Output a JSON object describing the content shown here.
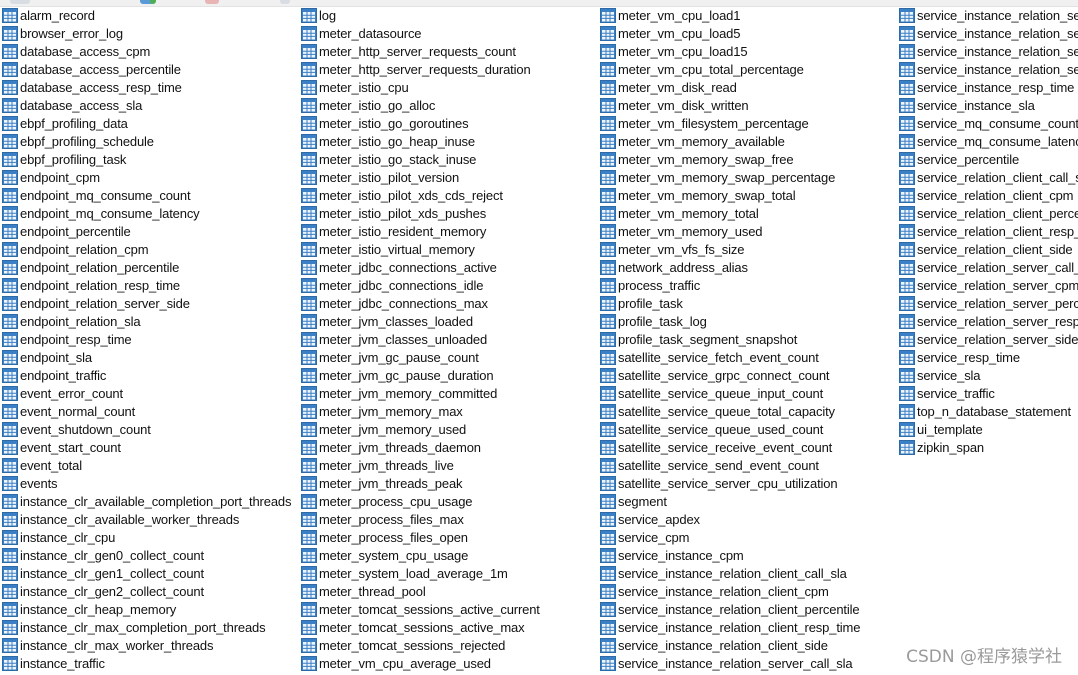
{
  "colors": {
    "table_icon": "#3b7fc4",
    "icon_grid": "#ffffff",
    "text": "#111111",
    "watermark": "#9a9a9a"
  },
  "icons": {
    "table": "table-grid-icon"
  },
  "columns": [
    {
      "items": [
        "alarm_record",
        "browser_error_log",
        "database_access_cpm",
        "database_access_percentile",
        "database_access_resp_time",
        "database_access_sla",
        "ebpf_profiling_data",
        "ebpf_profiling_schedule",
        "ebpf_profiling_task",
        "endpoint_cpm",
        "endpoint_mq_consume_count",
        "endpoint_mq_consume_latency",
        "endpoint_percentile",
        "endpoint_relation_cpm",
        "endpoint_relation_percentile",
        "endpoint_relation_resp_time",
        "endpoint_relation_server_side",
        "endpoint_relation_sla",
        "endpoint_resp_time",
        "endpoint_sla",
        "endpoint_traffic",
        "event_error_count",
        "event_normal_count",
        "event_shutdown_count",
        "event_start_count",
        "event_total",
        "events",
        "instance_clr_available_completion_port_threads",
        "instance_clr_available_worker_threads",
        "instance_clr_cpu",
        "instance_clr_gen0_collect_count",
        "instance_clr_gen1_collect_count",
        "instance_clr_gen2_collect_count",
        "instance_clr_heap_memory",
        "instance_clr_max_completion_port_threads",
        "instance_clr_max_worker_threads",
        "instance_traffic"
      ]
    },
    {
      "items": [
        "log",
        "meter_datasource",
        "meter_http_server_requests_count",
        "meter_http_server_requests_duration",
        "meter_istio_cpu",
        "meter_istio_go_alloc",
        "meter_istio_go_goroutines",
        "meter_istio_go_heap_inuse",
        "meter_istio_go_stack_inuse",
        "meter_istio_pilot_version",
        "meter_istio_pilot_xds_cds_reject",
        "meter_istio_pilot_xds_pushes",
        "meter_istio_resident_memory",
        "meter_istio_virtual_memory",
        "meter_jdbc_connections_active",
        "meter_jdbc_connections_idle",
        "meter_jdbc_connections_max",
        "meter_jvm_classes_loaded",
        "meter_jvm_classes_unloaded",
        "meter_jvm_gc_pause_count",
        "meter_jvm_gc_pause_duration",
        "meter_jvm_memory_committed",
        "meter_jvm_memory_max",
        "meter_jvm_memory_used",
        "meter_jvm_threads_daemon",
        "meter_jvm_threads_live",
        "meter_jvm_threads_peak",
        "meter_process_cpu_usage",
        "meter_process_files_max",
        "meter_process_files_open",
        "meter_system_cpu_usage",
        "meter_system_load_average_1m",
        "meter_thread_pool",
        "meter_tomcat_sessions_active_current",
        "meter_tomcat_sessions_active_max",
        "meter_tomcat_sessions_rejected",
        "meter_vm_cpu_average_used"
      ]
    },
    {
      "items": [
        "meter_vm_cpu_load1",
        "meter_vm_cpu_load5",
        "meter_vm_cpu_load15",
        "meter_vm_cpu_total_percentage",
        "meter_vm_disk_read",
        "meter_vm_disk_written",
        "meter_vm_filesystem_percentage",
        "meter_vm_memory_available",
        "meter_vm_memory_swap_free",
        "meter_vm_memory_swap_percentage",
        "meter_vm_memory_swap_total",
        "meter_vm_memory_total",
        "meter_vm_memory_used",
        "meter_vm_vfs_fs_size",
        "network_address_alias",
        "process_traffic",
        "profile_task",
        "profile_task_log",
        "profile_task_segment_snapshot",
        "satellite_service_fetch_event_count",
        "satellite_service_grpc_connect_count",
        "satellite_service_queue_input_count",
        "satellite_service_queue_total_capacity",
        "satellite_service_queue_used_count",
        "satellite_service_receive_event_count",
        "satellite_service_send_event_count",
        "satellite_service_server_cpu_utilization",
        "segment",
        "service_apdex",
        "service_cpm",
        "service_instance_cpm",
        "service_instance_relation_client_call_sla",
        "service_instance_relation_client_cpm",
        "service_instance_relation_client_percentile",
        "service_instance_relation_client_resp_time",
        "service_instance_relation_client_side",
        "service_instance_relation_server_call_sla"
      ]
    },
    {
      "items": [
        "service_instance_relation_ser",
        "service_instance_relation_ser",
        "service_instance_relation_ser",
        "service_instance_relation_ser",
        "service_instance_resp_time",
        "service_instance_sla",
        "service_mq_consume_count",
        "service_mq_consume_latenc",
        "service_percentile",
        "service_relation_client_call_sl",
        "service_relation_client_cpm",
        "service_relation_client_perce",
        "service_relation_client_resp_",
        "service_relation_client_side",
        "service_relation_server_call_",
        "service_relation_server_cpm",
        "service_relation_server_perc",
        "service_relation_server_resp",
        "service_relation_server_side",
        "service_resp_time",
        "service_sla",
        "service_traffic",
        "top_n_database_statement",
        "ui_template",
        "zipkin_span"
      ]
    }
  ],
  "watermark": "CSDN @程序猿学社"
}
